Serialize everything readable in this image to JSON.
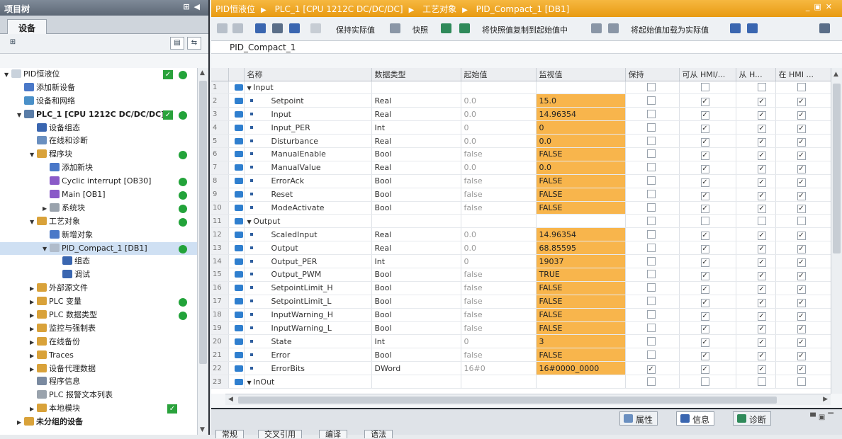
{
  "left_panel": {
    "title": "项目树",
    "tab": "设备",
    "tree": [
      {
        "label": "PID恒液位",
        "level": 0,
        "arrow": "▼",
        "icon": "#c9d2dc",
        "check": true,
        "green": true
      },
      {
        "label": "添加新设备",
        "level": 1,
        "arrow": "",
        "icon": "#4a78c8"
      },
      {
        "label": "设备和网络",
        "level": 1,
        "arrow": "",
        "icon": "#4a90c8"
      },
      {
        "label": "PLC_1 [CPU 1212C DC/DC/DC]",
        "level": 1,
        "arrow": "▼",
        "icon": "#5a7da8",
        "bold": true,
        "check": true,
        "green": true
      },
      {
        "label": "设备组态",
        "level": 2,
        "arrow": "",
        "icon": "#3a66b0"
      },
      {
        "label": "在线和诊断",
        "level": 2,
        "arrow": "",
        "icon": "#6a8fc0"
      },
      {
        "label": "程序块",
        "level": 2,
        "arrow": "▼",
        "icon": "#d9a23a",
        "green": true
      },
      {
        "label": "添加新块",
        "level": 3,
        "arrow": "",
        "icon": "#4a78c8"
      },
      {
        "label": "Cyclic interrupt [OB30]",
        "level": 3,
        "arrow": "",
        "icon": "#8a5ac8",
        "green": true
      },
      {
        "label": "Main [OB1]",
        "level": 3,
        "arrow": "",
        "icon": "#8a5ac8",
        "green": true
      },
      {
        "label": "系统块",
        "level": 3,
        "arrow": "▶",
        "icon": "#9aa3ad",
        "green": true
      },
      {
        "label": "工艺对象",
        "level": 2,
        "arrow": "▼",
        "icon": "#d9a23a",
        "green": true
      },
      {
        "label": "新增对象",
        "level": 3,
        "arrow": "",
        "icon": "#4a78c8"
      },
      {
        "label": "PID_Compact_1 [DB1]",
        "level": 3,
        "arrow": "▼",
        "icon": "#b0bccb",
        "green": true,
        "selected": true
      },
      {
        "label": "组态",
        "level": 4,
        "arrow": "",
        "icon": "#3a66b0"
      },
      {
        "label": "调试",
        "level": 4,
        "arrow": "",
        "icon": "#3a66b0"
      },
      {
        "label": "外部源文件",
        "level": 2,
        "arrow": "▶",
        "icon": "#d9a23a"
      },
      {
        "label": "PLC 变量",
        "level": 2,
        "arrow": "▶",
        "icon": "#d9a23a",
        "green": true
      },
      {
        "label": "PLC 数据类型",
        "level": 2,
        "arrow": "▶",
        "icon": "#d9a23a",
        "green": true
      },
      {
        "label": "监控与强制表",
        "level": 2,
        "arrow": "▶",
        "icon": "#d9a23a"
      },
      {
        "label": "在线备份",
        "level": 2,
        "arrow": "▶",
        "icon": "#d9a23a"
      },
      {
        "label": "Traces",
        "level": 2,
        "arrow": "▶",
        "icon": "#d9a23a"
      },
      {
        "label": "设备代理数据",
        "level": 2,
        "arrow": "▶",
        "icon": "#d9a23a"
      },
      {
        "label": "程序信息",
        "level": 2,
        "arrow": "",
        "icon": "#7a8aa0"
      },
      {
        "label": "PLC 报警文本列表",
        "level": 2,
        "arrow": "",
        "icon": "#9aa3ad"
      },
      {
        "label": "本地模块",
        "level": 2,
        "arrow": "▶",
        "icon": "#d9a23a",
        "check_solo": true
      },
      {
        "label": "未分组的设备",
        "level": 1,
        "arrow": "▶",
        "icon": "#d9a23a",
        "bold": true
      }
    ]
  },
  "breadcrumb": [
    "PID恒液位",
    "PLC_1 [CPU 1212C DC/DC/DC]",
    "工艺对象",
    "PID_Compact_1 [DB1]"
  ],
  "toolbar": {
    "keep_actual": "保持实际值",
    "snapshot": "快照",
    "copy_snapshot": "将快照值复制到起始值中",
    "load_start": "将起始值加载为实际值"
  },
  "db_name": "PID_Compact_1",
  "columns": [
    "名称",
    "数据类型",
    "起始值",
    "监视值",
    "保持",
    "可从 HMI/...",
    "从 H...",
    "在 HMI ..."
  ],
  "rows": [
    {
      "n": "1",
      "name": "Input",
      "section": true
    },
    {
      "n": "2",
      "name": "Setpoint",
      "type": "Real",
      "start": "0.0",
      "mon": "15.0",
      "keep": false
    },
    {
      "n": "3",
      "name": "Input",
      "type": "Real",
      "start": "0.0",
      "mon": "14.96354",
      "keep": false
    },
    {
      "n": "4",
      "name": "Input_PER",
      "type": "Int",
      "start": "0",
      "mon": "0",
      "keep": false
    },
    {
      "n": "5",
      "name": "Disturbance",
      "type": "Real",
      "start": "0.0",
      "mon": "0.0",
      "keep": false
    },
    {
      "n": "6",
      "name": "ManualEnable",
      "type": "Bool",
      "start": "false",
      "mon": "FALSE",
      "keep": false
    },
    {
      "n": "7",
      "name": "ManualValue",
      "type": "Real",
      "start": "0.0",
      "mon": "0.0",
      "keep": false
    },
    {
      "n": "8",
      "name": "ErrorAck",
      "type": "Bool",
      "start": "false",
      "mon": "FALSE",
      "keep": false
    },
    {
      "n": "9",
      "name": "Reset",
      "type": "Bool",
      "start": "false",
      "mon": "FALSE",
      "keep": false
    },
    {
      "n": "10",
      "name": "ModeActivate",
      "type": "Bool",
      "start": "false",
      "mon": "FALSE",
      "keep": false
    },
    {
      "n": "11",
      "name": "Output",
      "section": true
    },
    {
      "n": "12",
      "name": "ScaledInput",
      "type": "Real",
      "start": "0.0",
      "mon": "14.96354",
      "keep": false
    },
    {
      "n": "13",
      "name": "Output",
      "type": "Real",
      "start": "0.0",
      "mon": "68.85595",
      "keep": false
    },
    {
      "n": "14",
      "name": "Output_PER",
      "type": "Int",
      "start": "0",
      "mon": "19037",
      "keep": false
    },
    {
      "n": "15",
      "name": "Output_PWM",
      "type": "Bool",
      "start": "false",
      "mon": "TRUE",
      "keep": false
    },
    {
      "n": "16",
      "name": "SetpointLimit_H",
      "type": "Bool",
      "start": "false",
      "mon": "FALSE",
      "keep": false
    },
    {
      "n": "17",
      "name": "SetpointLimit_L",
      "type": "Bool",
      "start": "false",
      "mon": "FALSE",
      "keep": false
    },
    {
      "n": "18",
      "name": "InputWarning_H",
      "type": "Bool",
      "start": "false",
      "mon": "FALSE",
      "keep": false
    },
    {
      "n": "19",
      "name": "InputWarning_L",
      "type": "Bool",
      "start": "false",
      "mon": "FALSE",
      "keep": false
    },
    {
      "n": "20",
      "name": "State",
      "type": "Int",
      "start": "0",
      "mon": "3",
      "keep": false
    },
    {
      "n": "21",
      "name": "Error",
      "type": "Bool",
      "start": "false",
      "mon": "FALSE",
      "keep": false
    },
    {
      "n": "22",
      "name": "ErrorBits",
      "type": "DWord",
      "start": "16#0",
      "mon": "16#0000_0000",
      "keep": true
    },
    {
      "n": "23",
      "name": "InOut",
      "section": true
    }
  ],
  "bottom_tabs": [
    "属性",
    "信息",
    "诊断"
  ],
  "bottom_subtabs": [
    "常规",
    "交叉引用",
    "编译",
    "语法"
  ],
  "colors": {
    "accent": "#e89a12",
    "monitor": "#f8b54c",
    "ok": "#22a33a"
  }
}
